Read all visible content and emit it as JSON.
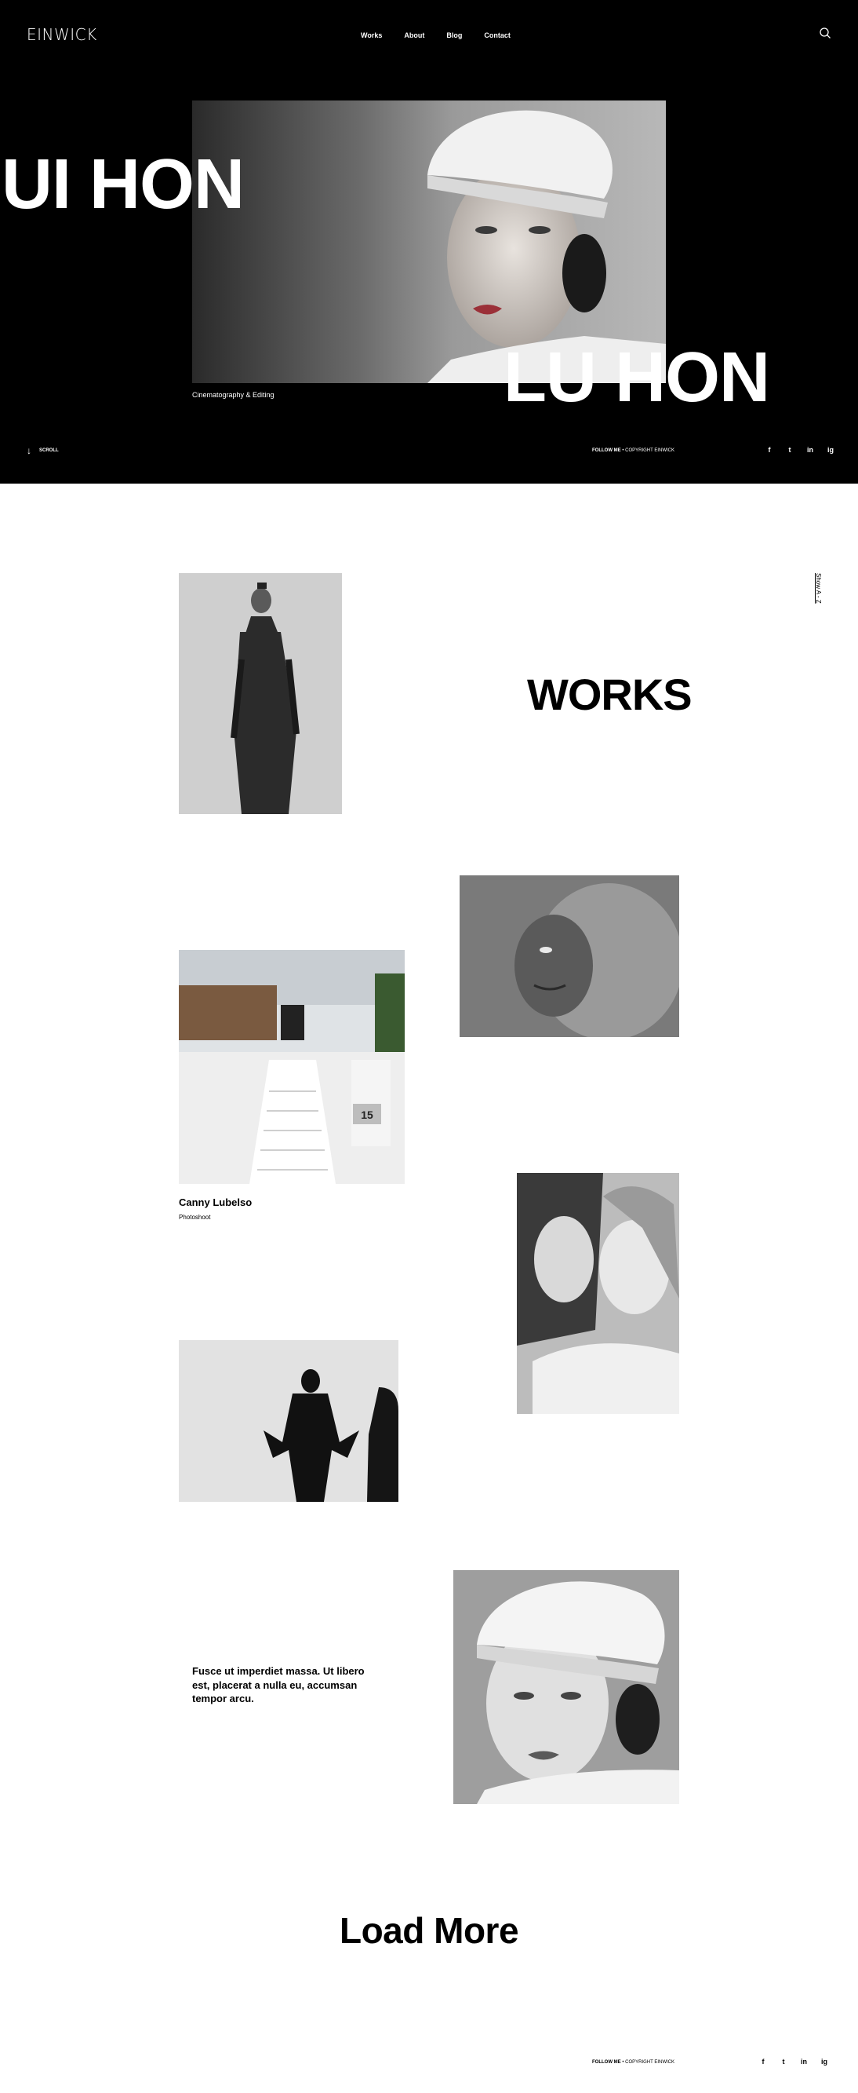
{
  "header": {
    "logo": "EINWICK",
    "nav": [
      "Works",
      "About",
      "Blog",
      "Contact"
    ],
    "search_icon": "search-icon"
  },
  "hero": {
    "title_line1": "UI HON",
    "title_line2": "LU HON",
    "subtitle": "Cinematography & Editing",
    "scroll_label": "SCROLL",
    "follow_label": "FOLLOW ME",
    "copyright": "COPYRIGHT EINWICK",
    "socials": [
      "f",
      "t",
      "in",
      "ig"
    ]
  },
  "works": {
    "side_link": "Show A - Z",
    "title": "WORKS",
    "featured_item": {
      "title": "Canny Lubelso",
      "category": "Photoshoot"
    },
    "quote": "Fusce ut imperdiet massa. Ut libero est, placerat a nulla eu, accumsan tempor arcu.",
    "load_more": "Load More"
  },
  "footer": {
    "follow_label": "FOLLOW ME",
    "copyright": "COPYRIGHT EINWICK",
    "socials": [
      "f",
      "t",
      "in",
      "ig"
    ]
  },
  "colors": {
    "background": "#ffffff",
    "hero": "#000000",
    "text": "#000000"
  }
}
